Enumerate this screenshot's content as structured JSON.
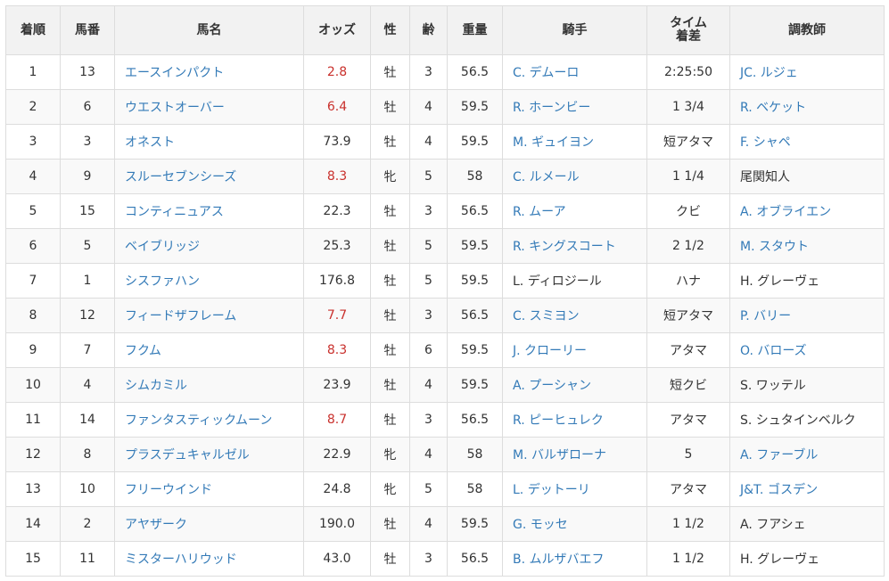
{
  "headers": {
    "rank": "着順",
    "number": "馬番",
    "horse": "馬名",
    "odds": "オッズ",
    "sex": "性",
    "age": "齢",
    "weight": "重量",
    "jockey": "騎手",
    "time_line1": "タイム",
    "time_line2": "着差",
    "trainer": "調教師"
  },
  "colors": {
    "link": "#337ab7",
    "favorite_odds": "#c9302c",
    "header_bg": "#f2f2f2",
    "stripe_bg": "#f9f9f9"
  },
  "rows": [
    {
      "rank": "1",
      "number": "13",
      "horse": "エースインパクト",
      "odds": "2.8",
      "odds_fav": true,
      "sex": "牡",
      "age": "3",
      "weight": "56.5",
      "jockey": "C. デムーロ",
      "jockey_link": true,
      "time": "2:25:50",
      "trainer": "JC. ルジェ",
      "trainer_link": true
    },
    {
      "rank": "2",
      "number": "6",
      "horse": "ウエストオーバー",
      "odds": "6.4",
      "odds_fav": true,
      "sex": "牡",
      "age": "4",
      "weight": "59.5",
      "jockey": "R. ホーンビー",
      "jockey_link": true,
      "time": "1 3/4",
      "trainer": "R. ベケット",
      "trainer_link": true
    },
    {
      "rank": "3",
      "number": "3",
      "horse": "オネスト",
      "odds": "73.9",
      "odds_fav": false,
      "sex": "牡",
      "age": "4",
      "weight": "59.5",
      "jockey": "M. ギュイヨン",
      "jockey_link": true,
      "time": "短アタマ",
      "trainer": "F. シャペ",
      "trainer_link": true
    },
    {
      "rank": "4",
      "number": "9",
      "horse": "スルーセブンシーズ",
      "odds": "8.3",
      "odds_fav": true,
      "sex": "牝",
      "age": "5",
      "weight": "58",
      "jockey": "C. ルメール",
      "jockey_link": true,
      "time": "1 1/4",
      "trainer": "尾関知人",
      "trainer_link": false
    },
    {
      "rank": "5",
      "number": "15",
      "horse": "コンティニュアス",
      "odds": "22.3",
      "odds_fav": false,
      "sex": "牡",
      "age": "3",
      "weight": "56.5",
      "jockey": "R. ムーア",
      "jockey_link": true,
      "time": "クビ",
      "trainer": "A. オブライエン",
      "trainer_link": true
    },
    {
      "rank": "6",
      "number": "5",
      "horse": "ベイブリッジ",
      "odds": "25.3",
      "odds_fav": false,
      "sex": "牡",
      "age": "5",
      "weight": "59.5",
      "jockey": "R. キングスコート",
      "jockey_link": true,
      "time": "2 1/2",
      "trainer": "M. スタウト",
      "trainer_link": true
    },
    {
      "rank": "7",
      "number": "1",
      "horse": "シスファハン",
      "odds": "176.8",
      "odds_fav": false,
      "sex": "牡",
      "age": "5",
      "weight": "59.5",
      "jockey": "L. ディロジール",
      "jockey_link": false,
      "time": "ハナ",
      "trainer": "H. グレーヴェ",
      "trainer_link": false
    },
    {
      "rank": "8",
      "number": "12",
      "horse": "フィードザフレーム",
      "odds": "7.7",
      "odds_fav": true,
      "sex": "牡",
      "age": "3",
      "weight": "56.5",
      "jockey": "C. スミヨン",
      "jockey_link": true,
      "time": "短アタマ",
      "trainer": "P. バリー",
      "trainer_link": true
    },
    {
      "rank": "9",
      "number": "7",
      "horse": "フクム",
      "odds": "8.3",
      "odds_fav": true,
      "sex": "牡",
      "age": "6",
      "weight": "59.5",
      "jockey": "J. クローリー",
      "jockey_link": true,
      "time": "アタマ",
      "trainer": "O. バローズ",
      "trainer_link": true
    },
    {
      "rank": "10",
      "number": "4",
      "horse": "シムカミル",
      "odds": "23.9",
      "odds_fav": false,
      "sex": "牡",
      "age": "4",
      "weight": "59.5",
      "jockey": "A. プーシャン",
      "jockey_link": true,
      "time": "短クビ",
      "trainer": "S. ワッテル",
      "trainer_link": false
    },
    {
      "rank": "11",
      "number": "14",
      "horse": "ファンタスティックムーン",
      "odds": "8.7",
      "odds_fav": true,
      "sex": "牡",
      "age": "3",
      "weight": "56.5",
      "jockey": "R. ピーヒュレク",
      "jockey_link": true,
      "time": "アタマ",
      "trainer": "S. シュタインベルク",
      "trainer_link": false
    },
    {
      "rank": "12",
      "number": "8",
      "horse": "プラスデュキャルゼル",
      "odds": "22.9",
      "odds_fav": false,
      "sex": "牝",
      "age": "4",
      "weight": "58",
      "jockey": "M. バルザローナ",
      "jockey_link": true,
      "time": "5",
      "trainer": "A. ファーブル",
      "trainer_link": true
    },
    {
      "rank": "13",
      "number": "10",
      "horse": "フリーウインド",
      "odds": "24.8",
      "odds_fav": false,
      "sex": "牝",
      "age": "5",
      "weight": "58",
      "jockey": "L. デットーリ",
      "jockey_link": true,
      "time": "アタマ",
      "trainer": "J&T. ゴスデン",
      "trainer_link": true
    },
    {
      "rank": "14",
      "number": "2",
      "horse": "アヤザーク",
      "odds": "190.0",
      "odds_fav": false,
      "sex": "牡",
      "age": "4",
      "weight": "59.5",
      "jockey": "G. モッセ",
      "jockey_link": true,
      "time": "1 1/2",
      "trainer": "A. フアシェ",
      "trainer_link": false
    },
    {
      "rank": "15",
      "number": "11",
      "horse": "ミスターハリウッド",
      "odds": "43.0",
      "odds_fav": false,
      "sex": "牡",
      "age": "3",
      "weight": "56.5",
      "jockey": "B. ムルザバエフ",
      "jockey_link": true,
      "time": "1 1/2",
      "trainer": "H. グレーヴェ",
      "trainer_link": false
    }
  ]
}
